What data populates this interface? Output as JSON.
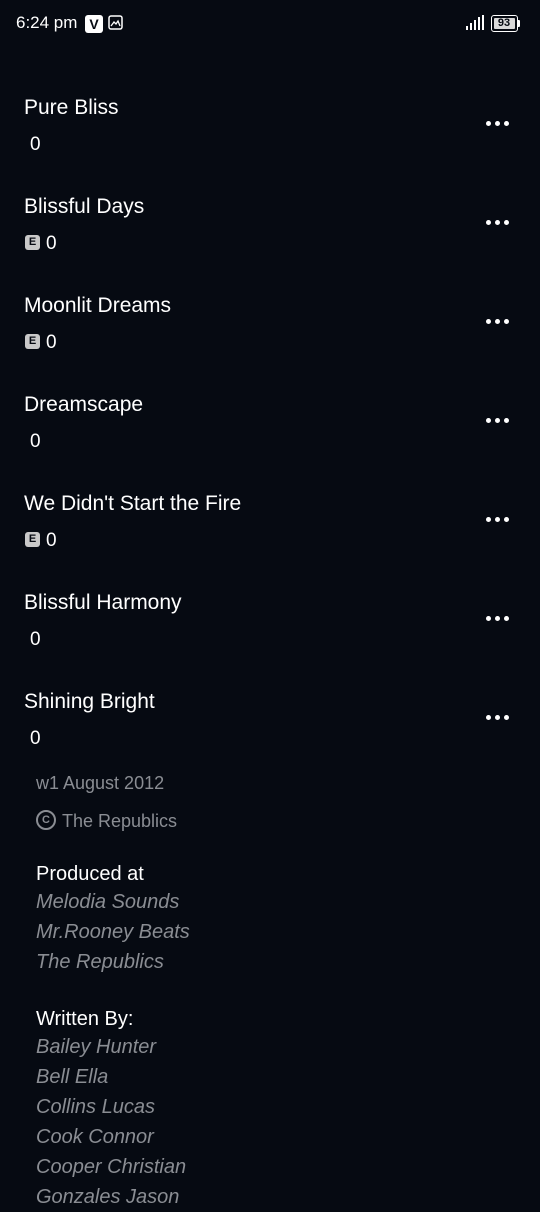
{
  "status_bar": {
    "time": "6:24 pm",
    "notification_badge": "V",
    "battery": "93"
  },
  "partial_row": {
    "explicit": "E",
    "plays": "0"
  },
  "tracks": [
    {
      "title": "Pure Bliss",
      "explicit": false,
      "plays": "0"
    },
    {
      "title": "Blissful Days",
      "explicit": true,
      "explicit_label": "E",
      "plays": "0"
    },
    {
      "title": "Moonlit Dreams",
      "explicit": true,
      "explicit_label": "E",
      "plays": "0"
    },
    {
      "title": "Dreamscape",
      "explicit": false,
      "plays": "0"
    },
    {
      "title": "We Didn't Start the Fire",
      "explicit": true,
      "explicit_label": "E",
      "plays": "0"
    },
    {
      "title": "Blissful Harmony",
      "explicit": false,
      "plays": "0"
    },
    {
      "title": "Shining Bright",
      "explicit": false,
      "plays": "0"
    }
  ],
  "release": {
    "date": "w1 August 2012",
    "copyright_symbol": "C",
    "copyright": "The Republics"
  },
  "credits": {
    "produced_heading": "Produced at",
    "produced": [
      "Melodia Sounds",
      "Mr.Rooney Beats",
      "The Republics"
    ],
    "written_heading": "Written By:",
    "written": [
      "Bailey Hunter",
      "Bell Ella",
      "Collins Lucas",
      "Cook Connor",
      "Cooper Christian",
      "Gonzales Jason"
    ]
  },
  "icons": {
    "more": "more-horizontal-icon",
    "gallery": "gallery-icon",
    "signal": "signal-icon",
    "battery": "battery-icon"
  },
  "colors": {
    "background": "#060a12",
    "text_primary": "#ffffff",
    "text_secondary": "#8a8d93",
    "badge": "#c9c9c9"
  }
}
